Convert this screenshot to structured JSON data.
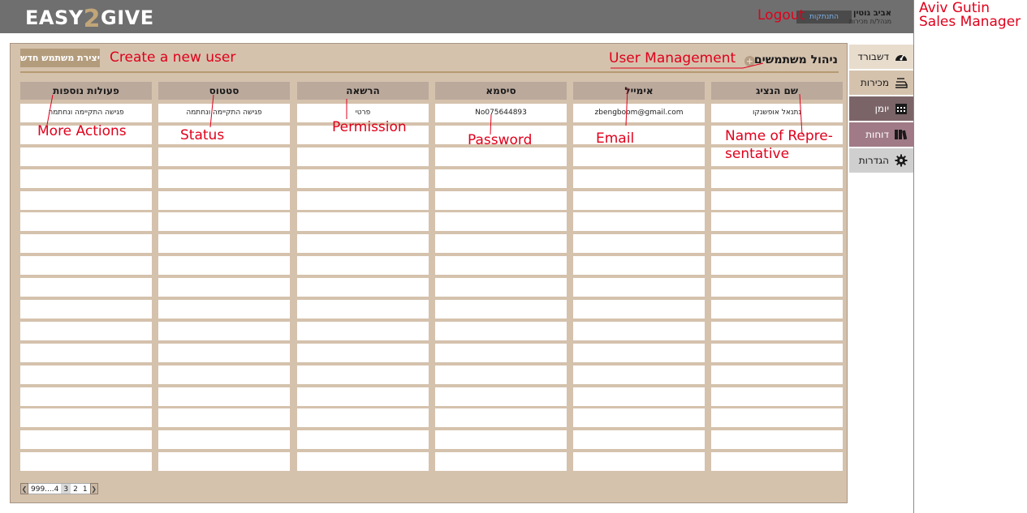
{
  "header": {
    "logo_left": "EASY",
    "logo_mid": "2",
    "logo_right": "GIVE",
    "user_name": "אביב גוטין",
    "user_role": "מנהל/ת מכירות",
    "logout_label": "התנתקות"
  },
  "annotations": {
    "logout": "Logout",
    "side_name": "Aviv Gutin",
    "side_role": "Sales Manager",
    "create_user": "Create a new user",
    "user_management": "User Management",
    "more_actions": "More Actions",
    "status": "Status",
    "permission": "Permission",
    "password": "Password",
    "email": "Email",
    "name_rep_line1": "Name of Repre-",
    "name_rep_line2": "sentative"
  },
  "sidebar": {
    "items": [
      {
        "label": "דשבורד",
        "icon": "dashboard-icon",
        "bg": "#e8dccd",
        "color": "#1a1a1a"
      },
      {
        "label": "מכירות",
        "icon": "sales-icon",
        "bg": "#d5c2ad",
        "color": "#1a1a1a"
      },
      {
        "label": "יומן",
        "icon": "calendar-icon",
        "bg": "#7b6468",
        "color": "#ffffff"
      },
      {
        "label": "דוחות",
        "icon": "reports-icon",
        "bg": "#a07a86",
        "color": "#ffffff"
      },
      {
        "label": "הגדרות",
        "icon": "gear-icon",
        "bg": "#cfcfcf",
        "color": "#1a1a1a"
      }
    ]
  },
  "main": {
    "title": "ניהול משתמשים",
    "create_button": "יצירת משתמש חדש",
    "columns": [
      {
        "header": "שם הנציג",
        "first": "נתנאל אופשנקו"
      },
      {
        "header": "אימייל",
        "first": "zbengboom@gmail.com"
      },
      {
        "header": "סיסמא",
        "first": "No075644893"
      },
      {
        "header": "הרשאה",
        "first": "פרטי"
      },
      {
        "header": "סטטוס",
        "first": "פגישה התקיימה ונחתמה"
      },
      {
        "header": "פעולות נוספות",
        "first": "פגישה התקיימה ונחתמה"
      }
    ],
    "row_count": 17
  },
  "pagination": {
    "ellipsis": "999....4",
    "pages": [
      "3",
      "2",
      "1"
    ]
  },
  "colors": {
    "accent_red": "#e0001b",
    "panel_bg": "#d5c2ad",
    "header_bg": "#bba99c",
    "topbar_bg": "#6f6f6f"
  }
}
